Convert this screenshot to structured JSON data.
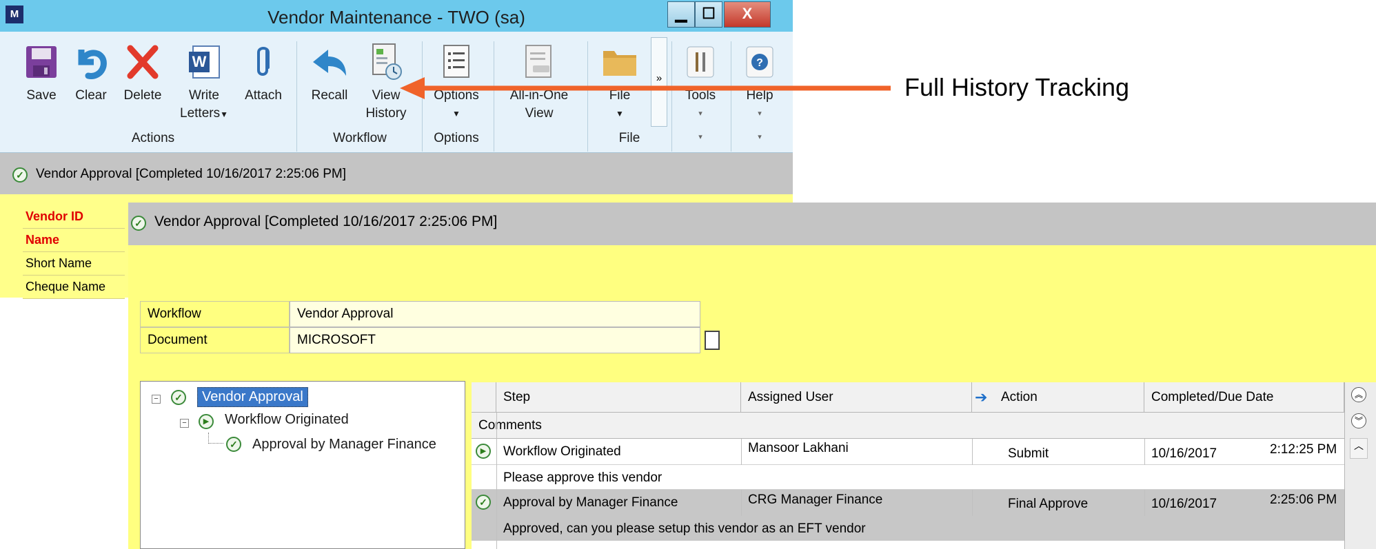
{
  "window": {
    "title": "Vendor Maintenance  -  TWO (sa)",
    "logo_text": "M",
    "controls": {
      "minimize": "▁",
      "maximize": "☐",
      "close": "X"
    }
  },
  "ribbon": {
    "buttons": {
      "save": "Save",
      "clear": "Clear",
      "delete": "Delete",
      "write_letters_1": "Write",
      "write_letters_2": "Letters",
      "attach": "Attach",
      "recall": "Recall",
      "view_history_1": "View",
      "view_history_2": "History",
      "options": "Options",
      "all_in_one_1": "All-in-One",
      "all_in_one_2": "View",
      "file": "File",
      "tools": "Tools",
      "help": "Help",
      "more": "»"
    },
    "groups": {
      "actions": "Actions",
      "workflow": "Workflow",
      "options": "Options",
      "file": "File"
    },
    "word_icon_text": "W"
  },
  "status": {
    "text": "Vendor Approval [Completed 10/16/2017 2:25:06 PM]"
  },
  "vendor_form": {
    "vendor_id": "Vendor ID",
    "name": "Name",
    "short_name": "Short Name",
    "cheque_name": "Cheque Name"
  },
  "callout": {
    "text": "Full History Tracking"
  },
  "history": {
    "header": "Vendor Approval [Completed 10/16/2017 2:25:06 PM]",
    "workflow_label": "Workflow",
    "workflow_value": "Vendor Approval",
    "document_label": "Document",
    "document_value": "MICROSOFT",
    "tree": {
      "root": "Vendor Approval",
      "child": "Workflow Originated",
      "grandchild": "Approval by Manager Finance"
    },
    "grid": {
      "columns": {
        "step": "Step",
        "assigned_user": "Assigned User",
        "action": "Action",
        "completed_due": "Completed/Due Date"
      },
      "comments_header": "Comments",
      "rows": [
        {
          "step": "Workflow Originated",
          "user": "Mansoor Lakhani",
          "action": "Submit",
          "date": "10/16/2017",
          "time": "2:12:25 PM",
          "comment": "Please approve this vendor"
        },
        {
          "step": "Approval by Manager Finance",
          "user": "CRG Manager Finance",
          "action": "Final Approve",
          "date": "10/16/2017",
          "time": "2:25:06 PM",
          "comment": "Approved, can you please setup this vendor as an EFT vendor"
        }
      ]
    }
  },
  "colors": {
    "accent_orange": "#f0632a",
    "form_yellow": "#ffff80",
    "title_blue": "#6cc9ec",
    "required_red": "#e00000"
  }
}
